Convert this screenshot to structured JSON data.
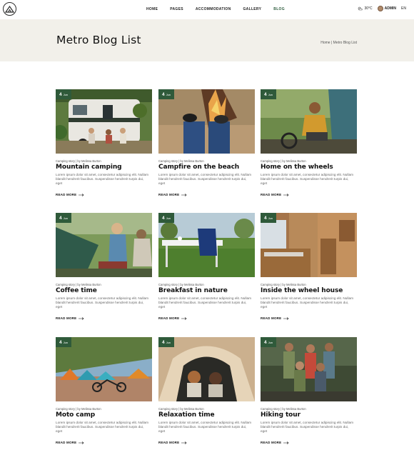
{
  "header": {
    "nav": [
      "HOME",
      "PAGES",
      "ACCOMMODATION",
      "GALLERY",
      "BLOG"
    ],
    "active_index": 4,
    "weather": "30°C",
    "user": "ADMIN",
    "language": "EN"
  },
  "hero": {
    "title": "Metro Blog List",
    "breadcrumb": "Home | Metro Blog List"
  },
  "colors": {
    "accent": "#2f5a3a",
    "hero_bg": "#f2f0ea"
  },
  "posts": [
    {
      "day": "4",
      "month": "Jun",
      "meta": "Camping story | by Melissa Burton",
      "title": "Mountain camping",
      "excerpt": "Lorem ipsum dolor sit amet, consectetur adipiscing elit. Nullam blandit hendrerit faucibus. Suspendisse hendrerit turpis dui, eget",
      "read_more": "READ MORE"
    },
    {
      "day": "4",
      "month": "Jun",
      "meta": "Camping story | by Melissa Burton",
      "title": "Campfire on the beach",
      "excerpt": "Lorem ipsum dolor sit amet, consectetur adipiscing elit. Nullam blandit hendrerit faucibus. Suspendisse hendrerit turpis dui, eget",
      "read_more": "READ MORE"
    },
    {
      "day": "4",
      "month": "Jun",
      "meta": "Camping story | by Melissa Burton",
      "title": "Home on the wheels",
      "excerpt": "Lorem ipsum dolor sit amet, consectetur adipiscing elit. Nullam blandit hendrerit faucibus. Suspendisse hendrerit turpis dui, eget",
      "read_more": "READ MORE"
    },
    {
      "day": "4",
      "month": "Jun",
      "meta": "Camping story | by Melissa Burton",
      "title": "Coffee time",
      "excerpt": "Lorem ipsum dolor sit amet, consectetur adipiscing elit. Nullam blandit hendrerit faucibus. Suspendisse hendrerit turpis dui, eget",
      "read_more": "READ MORE"
    },
    {
      "day": "4",
      "month": "Jun",
      "meta": "Camping story | by Melissa Burton",
      "title": "Breakfast in nature",
      "excerpt": "Lorem ipsum dolor sit amet, consectetur adipiscing elit. Nullam blandit hendrerit faucibus. Suspendisse hendrerit turpis dui, eget",
      "read_more": "READ MORE"
    },
    {
      "day": "4",
      "month": "Jun",
      "meta": "Camping story | by Melissa Burton",
      "title": "Inside the wheel house",
      "excerpt": "Lorem ipsum dolor sit amet, consectetur adipiscing elit. Nullam blandit hendrerit faucibus. Suspendisse hendrerit turpis dui, eget",
      "read_more": "READ MORE"
    },
    {
      "day": "4",
      "month": "Jun",
      "meta": "Camping story | by Melissa Burton",
      "title": "Moto camp",
      "excerpt": "Lorem ipsum dolor sit amet, consectetur adipiscing elit. Nullam blandit hendrerit faucibus. Suspendisse hendrerit turpis dui, eget",
      "read_more": "READ MORE"
    },
    {
      "day": "4",
      "month": "Jun",
      "meta": "Camping story | by Melissa Burton",
      "title": "Relaxation time",
      "excerpt": "Lorem ipsum dolor sit amet, consectetur adipiscing elit. Nullam blandit hendrerit faucibus. Suspendisse hendrerit turpis dui, eget",
      "read_more": "READ MORE"
    },
    {
      "day": "4",
      "month": "Jun",
      "meta": "Camping story | by Melissa Burton",
      "title": "Hiking tour",
      "excerpt": "Lorem ipsum dolor sit amet, consectetur adipiscing elit. Nullam blandit hendrerit faucibus. Suspendisse hendrerit turpis dui, eget",
      "read_more": "READ MORE"
    }
  ]
}
